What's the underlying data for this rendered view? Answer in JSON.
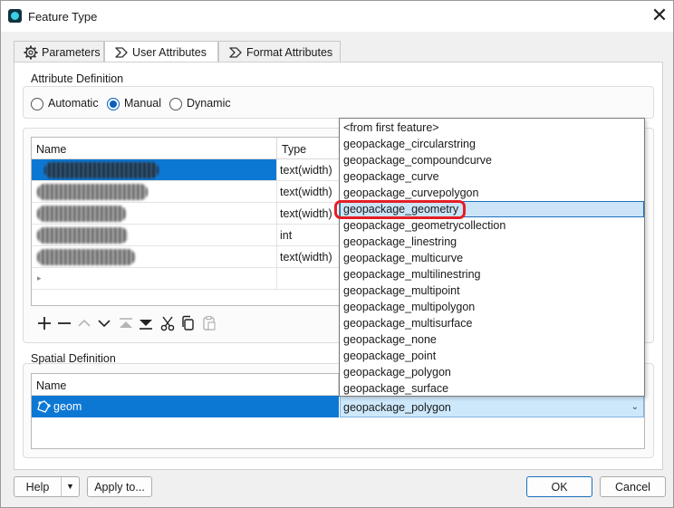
{
  "window": {
    "title": "Feature Type",
    "close_glyph": "✕"
  },
  "tabs": [
    {
      "label": "Parameters",
      "icon": "gear-icon"
    },
    {
      "label": "User Attributes",
      "icon": "attributes-icon"
    },
    {
      "label": "Format Attributes",
      "icon": "attributes-icon"
    }
  ],
  "active_tab": "User Attributes",
  "attribute_definition": {
    "label": "Attribute Definition",
    "modes": [
      {
        "label": "Automatic",
        "checked": false
      },
      {
        "label": "Manual",
        "checked": true
      },
      {
        "label": "Dynamic",
        "checked": false
      }
    ]
  },
  "attributes_table": {
    "columns": [
      "Name",
      "Type"
    ],
    "rows": [
      {
        "name": "",
        "type": "text(width)",
        "selected": true
      },
      {
        "name": "",
        "type": "text(width)",
        "selected": false
      },
      {
        "name": "",
        "type": "text(width)",
        "selected": false
      },
      {
        "name": "",
        "type": "int",
        "selected": false
      },
      {
        "name": "",
        "type": "text(width)",
        "selected": false
      }
    ],
    "new_row_marker": "▸"
  },
  "toolbar": [
    "add-icon",
    "remove-icon",
    "move-up-icon",
    "move-down-icon",
    "move-top-icon",
    "move-bottom-icon",
    "cut-icon",
    "copy-icon",
    "paste-icon"
  ],
  "spatial_definition": {
    "label": "Spatial Definition",
    "columns": [
      "Name"
    ],
    "row": {
      "name": "geom",
      "geometry_value": "geopackage_polygon",
      "icon": "geometry-icon"
    }
  },
  "geometry_dropdown": {
    "options": [
      "<from first feature>",
      "geopackage_circularstring",
      "geopackage_compoundcurve",
      "geopackage_curve",
      "geopackage_curvepolygon",
      "geopackage_geometry",
      "geopackage_geometrycollection",
      "geopackage_linestring",
      "geopackage_multicurve",
      "geopackage_multilinestring",
      "geopackage_multipoint",
      "geopackage_multipolygon",
      "geopackage_multisurface",
      "geopackage_none",
      "geopackage_point",
      "geopackage_polygon",
      "geopackage_surface"
    ],
    "highlighted": "geopackage_geometry",
    "annotation_color": "#e41e26"
  },
  "buttons": {
    "help": "Help",
    "apply_to": "Apply to...",
    "ok": "OK",
    "cancel": "Cancel"
  },
  "colors": {
    "selection": "#0d78d4",
    "accent": "#0a5fbf",
    "hover": "#cce4f7"
  }
}
